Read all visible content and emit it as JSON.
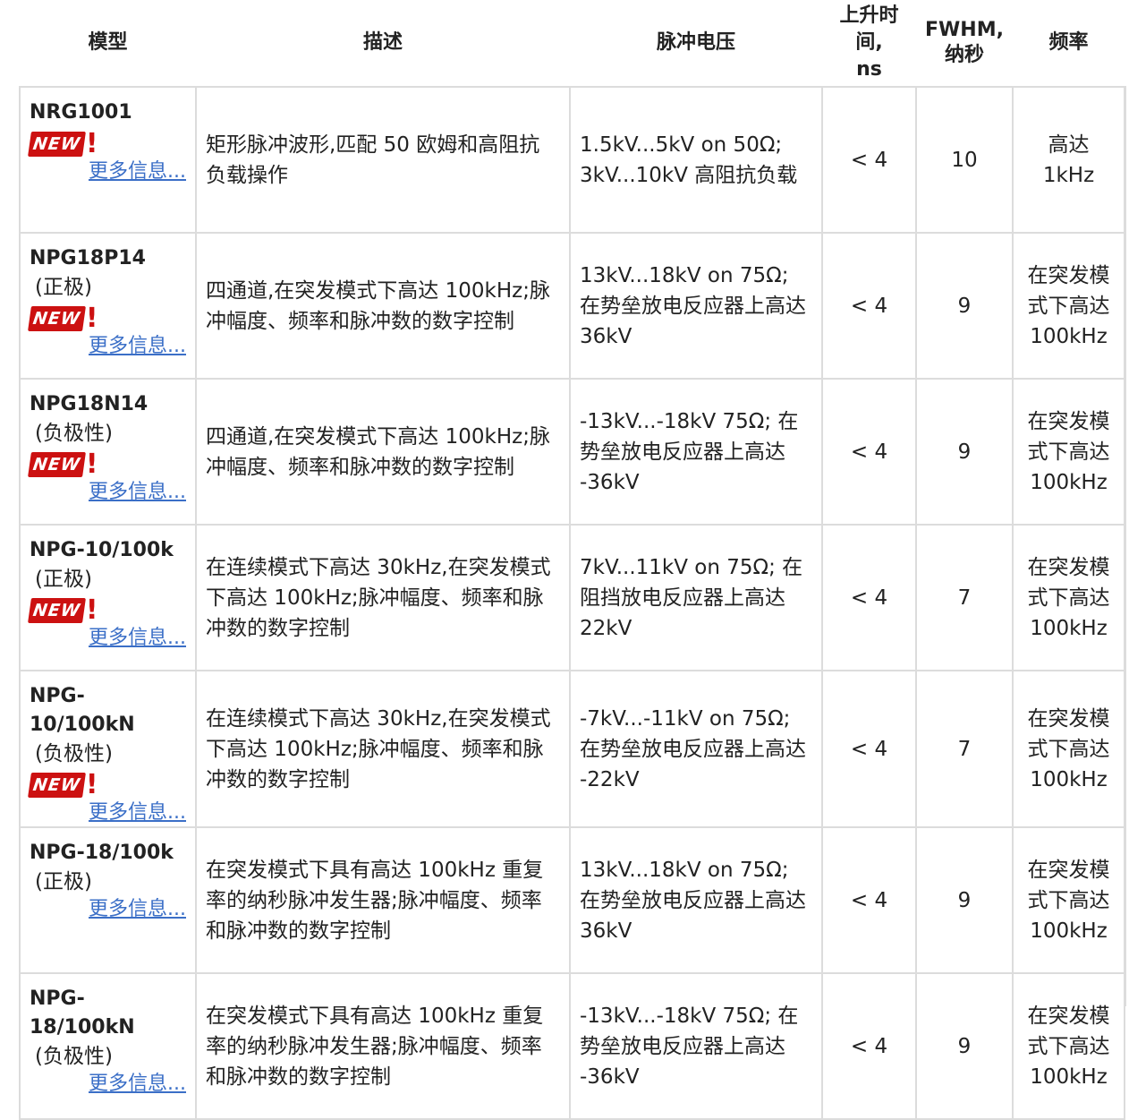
{
  "headers": {
    "model": "模型",
    "description": "描述",
    "voltage": "脉冲电压",
    "rise_line1": "上升时",
    "rise_line2": "间,",
    "rise_line3": "ns",
    "fwhm_line1": "FWHM,",
    "fwhm_line2": "纳秒",
    "frequency": "频率"
  },
  "badge": {
    "text": "NEW",
    "mark": "!"
  },
  "rows": [
    {
      "model": "NRG1001",
      "polarity": "",
      "is_new": true,
      "more": "更多信息...",
      "description": "矩形脉冲波形,匹配 50 欧姆和高阻抗负载操作",
      "voltage": "1.5kV...5kV on 50Ω; 3kV...10kV 高阻抗负载",
      "rise": "< 4",
      "fwhm": "10",
      "frequency": "高达 1kHz"
    },
    {
      "model": "NPG18P14",
      "polarity": "(正极)",
      "is_new": true,
      "more": "更多信息...",
      "description": "四通道,在突发模式下高达 100kHz;脉冲幅度、频率和脉冲数的数字控制",
      "voltage": "13kV...18kV on 75Ω; 在势垒放电反应器上高达 36kV",
      "rise": "< 4",
      "fwhm": "9",
      "frequency": "在突发模式下高达 100kHz"
    },
    {
      "model": "NPG18N14",
      "polarity": "(负极性)",
      "is_new": true,
      "more": "更多信息...",
      "description": "四通道,在突发模式下高达 100kHz;脉冲幅度、频率和脉冲数的数字控制",
      "voltage": "-13kV...-18kV 75Ω; 在势垒放电反应器上高达 -36kV",
      "rise": "< 4",
      "fwhm": "9",
      "frequency": "在突发模式下高达 100kHz"
    },
    {
      "model": "NPG-10/100k",
      "polarity": "(正极)",
      "is_new": true,
      "more": "更多信息...",
      "description": "在连续模式下高达 30kHz,在突发模式下高达 100kHz;脉冲幅度、频率和脉冲数的数字控制",
      "voltage": "7kV...11kV on 75Ω; 在阻挡放电反应器上高达 22kV",
      "rise": "< 4",
      "fwhm": "7",
      "frequency": "在突发模式下高达 100kHz"
    },
    {
      "model": "NPG-10/100kN",
      "polarity": "(负极性)",
      "is_new": true,
      "more": "更多信息...",
      "description": "在连续模式下高达 30kHz,在突发模式下高达 100kHz;脉冲幅度、频率和脉冲数的数字控制",
      "voltage": "-7kV...-11kV on 75Ω; 在势垒放电反应器上高达 -22kV",
      "rise": "< 4",
      "fwhm": "7",
      "frequency": "在突发模式下高达 100kHz"
    },
    {
      "model": "NPG-18/100k",
      "polarity": "(正极)",
      "is_new": false,
      "more": "更多信息...",
      "description": "在突发模式下具有高达 100kHz 重复率的纳秒脉冲发生器;脉冲幅度、频率和脉冲数的数字控制",
      "voltage": "13kV...18kV on 75Ω; 在势垒放电反应器上高达 36kV",
      "rise": "< 4",
      "fwhm": "9",
      "frequency": "在突发模式下高达 100kHz"
    },
    {
      "model": "NPG-18/100kN",
      "polarity": "(负极性)",
      "is_new": false,
      "more": "更多信息...",
      "description": "在突发模式下具有高达 100kHz 重复率的纳秒脉冲发生器;脉冲幅度、频率和脉冲数的数字控制",
      "voltage": "-13kV...-18kV 75Ω; 在势垒放电反应器上高达 -36kV",
      "rise": "< 4",
      "fwhm": "9",
      "frequency": "在突发模式下高达 100kHz"
    }
  ]
}
